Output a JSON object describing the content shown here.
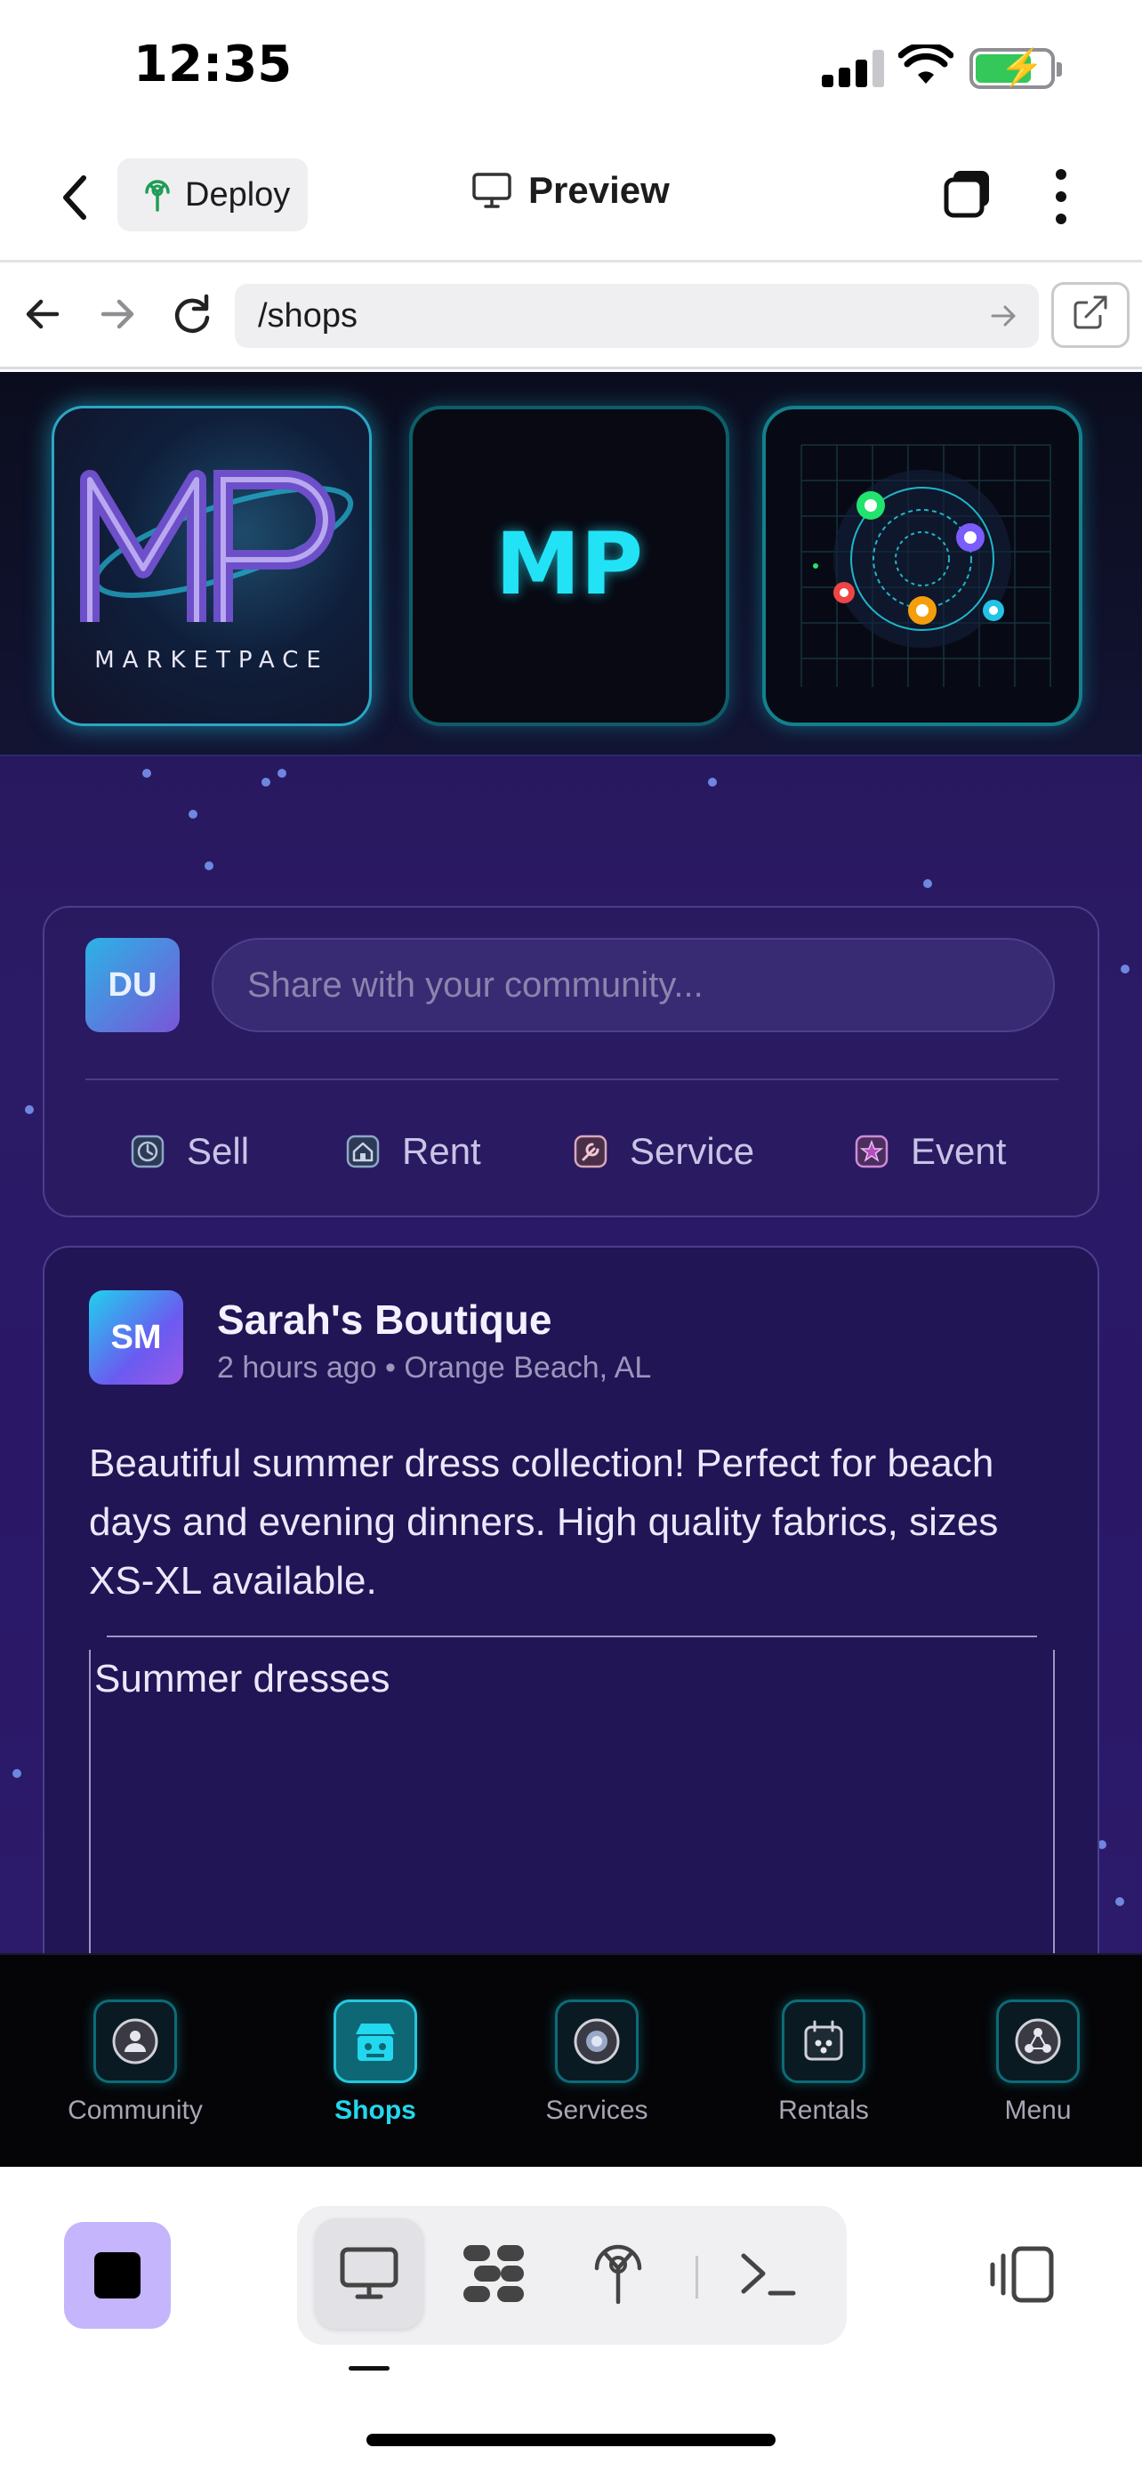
{
  "status_bar": {
    "time": "12:35"
  },
  "app_bar": {
    "deploy_label": "Deploy",
    "preview_label": "Preview"
  },
  "browser": {
    "url": "/shops"
  },
  "banner": {
    "logo_word": "MARKETPACE",
    "logo_badge": "MP"
  },
  "composer": {
    "avatar_initials": "DU",
    "placeholder": "Share with your community...",
    "actions": [
      {
        "label": "Sell",
        "icon": "clock-icon"
      },
      {
        "label": "Rent",
        "icon": "house-icon"
      },
      {
        "label": "Service",
        "icon": "wrench-icon"
      },
      {
        "label": "Event",
        "icon": "star-icon"
      }
    ]
  },
  "post": {
    "avatar_initials": "SM",
    "shop_name": "Sarah's Boutique",
    "meta": "2 hours ago • Orange Beach, AL",
    "body": "Beautiful summer dress collection! Perfect for beach days and evening dinners. High quality fabrics, sizes XS-XL available.",
    "image_alt": "Summer dresses"
  },
  "bottom_nav": {
    "items": [
      {
        "label": "Community",
        "icon": "community-icon"
      },
      {
        "label": "Shops",
        "icon": "shop-icon",
        "active": true
      },
      {
        "label": "Services",
        "icon": "services-icon"
      },
      {
        "label": "Rentals",
        "icon": "rentals-icon"
      },
      {
        "label": "Menu",
        "icon": "menu-icon"
      }
    ]
  },
  "colors": {
    "accent": "#22D8EE",
    "stop_button": "#C4B5FD",
    "background": "#2B1A66"
  }
}
